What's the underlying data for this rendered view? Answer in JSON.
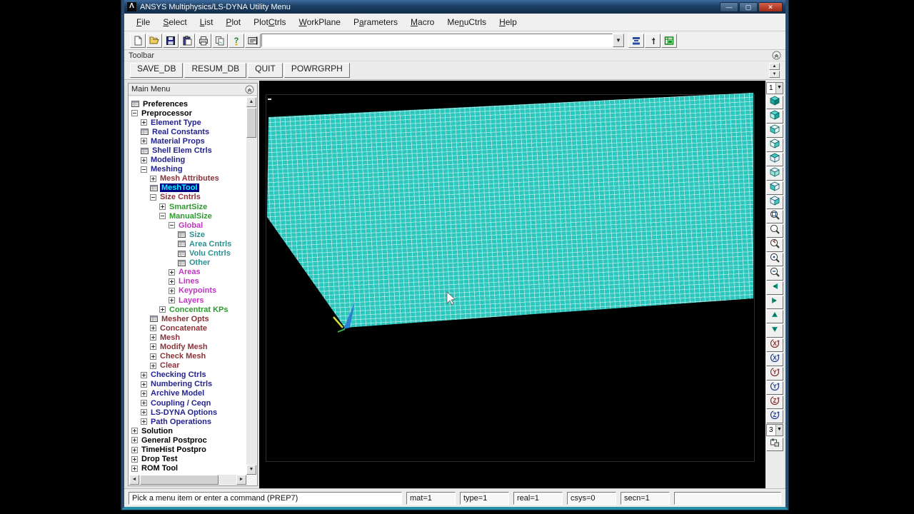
{
  "window": {
    "title": "ANSYS Multiphysics/LS-DYNA Utility Menu",
    "controls": [
      {
        "name": "minimize-button",
        "glyph": "—"
      },
      {
        "name": "maximize-button",
        "glyph": "▢"
      },
      {
        "name": "close-button",
        "glyph": "✕"
      }
    ]
  },
  "menu_bar": {
    "items": [
      {
        "label": "File",
        "hotkey_index": 0
      },
      {
        "label": "Select",
        "hotkey_index": 0
      },
      {
        "label": "List",
        "hotkey_index": 0
      },
      {
        "label": "Plot",
        "hotkey_index": 0
      },
      {
        "label": "PlotCtrls",
        "hotkey_index": 4
      },
      {
        "label": "WorkPlane",
        "hotkey_index": 0
      },
      {
        "label": "Parameters",
        "hotkey_index": 1
      },
      {
        "label": "Macro",
        "hotkey_index": 0
      },
      {
        "label": "MenuCtrls",
        "hotkey_index": 2
      },
      {
        "label": "Help",
        "hotkey_index": 0
      }
    ]
  },
  "standard_toolbar": {
    "left_icons": [
      "new-file-icon",
      "open-folder-icon",
      "save-icon",
      "paste-icon",
      "print-icon",
      "copy-icon",
      "help-key-icon"
    ],
    "command_button_icon": "command-entry-icon",
    "command_input": {
      "value": "",
      "placeholder": ""
    },
    "dropdown_glyph": "▼",
    "right_icons": [
      "raise-hidden-icon",
      "reset-picking-icon",
      "contact-manager-icon"
    ]
  },
  "toolbar_panel": {
    "label": "Toolbar",
    "buttons": [
      "SAVE_DB",
      "RESUM_DB",
      "QUIT",
      "POWRGRPH"
    ],
    "scroll_up_glyph": "▲",
    "scroll_down_glyph": "▼"
  },
  "main_menu": {
    "title": "Main Menu",
    "palette": {
      "black": "#000000",
      "navy": "#24248f",
      "maroon": "#8b3338",
      "green": "#2f9a2f",
      "magenta": "#c433c4",
      "teal": "#2e8f8f"
    },
    "selected_bg": "#000080",
    "selected_fg": "#00ffff",
    "items": [
      {
        "label": "Preferences",
        "level": 0,
        "icon": "sheet",
        "color": "black"
      },
      {
        "label": "Preprocessor",
        "level": 0,
        "icon": "minus",
        "color": "black"
      },
      {
        "label": "Element Type",
        "level": 1,
        "icon": "plus",
        "color": "navy"
      },
      {
        "label": "Real Constants",
        "level": 1,
        "icon": "sheet",
        "color": "navy"
      },
      {
        "label": "Material Props",
        "level": 1,
        "icon": "plus",
        "color": "navy"
      },
      {
        "label": "Shell Elem Ctrls",
        "level": 1,
        "icon": "sheet",
        "color": "navy"
      },
      {
        "label": "Modeling",
        "level": 1,
        "icon": "plus",
        "color": "navy"
      },
      {
        "label": "Meshing",
        "level": 1,
        "icon": "minus",
        "color": "navy"
      },
      {
        "label": "Mesh Attributes",
        "level": 2,
        "icon": "plus",
        "color": "maroon"
      },
      {
        "label": "MeshTool",
        "level": 2,
        "icon": "sheet",
        "color": "maroon",
        "selected": true
      },
      {
        "label": "Size Cntrls",
        "level": 2,
        "icon": "minus",
        "color": "maroon"
      },
      {
        "label": "SmartSize",
        "level": 3,
        "icon": "plus",
        "color": "green"
      },
      {
        "label": "ManualSize",
        "level": 3,
        "icon": "minus",
        "color": "green"
      },
      {
        "label": "Global",
        "level": 4,
        "icon": "minus",
        "color": "magenta"
      },
      {
        "label": "Size",
        "level": 5,
        "icon": "sheet",
        "color": "teal"
      },
      {
        "label": "Area Cntrls",
        "level": 5,
        "icon": "sheet",
        "color": "teal"
      },
      {
        "label": "Volu Cntrls",
        "level": 5,
        "icon": "sheet",
        "color": "teal"
      },
      {
        "label": "Other",
        "level": 5,
        "icon": "sheet",
        "color": "teal"
      },
      {
        "label": "Areas",
        "level": 4,
        "icon": "plus",
        "color": "magenta"
      },
      {
        "label": "Lines",
        "level": 4,
        "icon": "plus",
        "color": "magenta"
      },
      {
        "label": "Keypoints",
        "level": 4,
        "icon": "plus",
        "color": "magenta"
      },
      {
        "label": "Layers",
        "level": 4,
        "icon": "plus",
        "color": "magenta"
      },
      {
        "label": "Concentrat KPs",
        "level": 3,
        "icon": "plus",
        "color": "green"
      },
      {
        "label": "Mesher Opts",
        "level": 2,
        "icon": "sheet",
        "color": "maroon"
      },
      {
        "label": "Concatenate",
        "level": 2,
        "icon": "plus",
        "color": "maroon"
      },
      {
        "label": "Mesh",
        "level": 2,
        "icon": "plus",
        "color": "maroon"
      },
      {
        "label": "Modify Mesh",
        "level": 2,
        "icon": "plus",
        "color": "maroon"
      },
      {
        "label": "Check Mesh",
        "level": 2,
        "icon": "plus",
        "color": "maroon"
      },
      {
        "label": "Clear",
        "level": 2,
        "icon": "plus",
        "color": "maroon"
      },
      {
        "label": "Checking Ctrls",
        "level": 1,
        "icon": "plus",
        "color": "navy"
      },
      {
        "label": "Numbering Ctrls",
        "level": 1,
        "icon": "plus",
        "color": "navy"
      },
      {
        "label": "Archive Model",
        "level": 1,
        "icon": "plus",
        "color": "navy"
      },
      {
        "label": "Coupling / Ceqn",
        "level": 1,
        "icon": "plus",
        "color": "navy"
      },
      {
        "label": "LS-DYNA Options",
        "level": 1,
        "icon": "plus",
        "color": "navy"
      },
      {
        "label": "Path Operations",
        "level": 1,
        "icon": "plus",
        "color": "navy"
      },
      {
        "label": "Solution",
        "level": 0,
        "icon": "plus",
        "color": "black"
      },
      {
        "label": "General Postproc",
        "level": 0,
        "icon": "plus",
        "color": "black"
      },
      {
        "label": "TimeHist Postpro",
        "level": 0,
        "icon": "plus",
        "color": "black"
      },
      {
        "label": "Drop Test",
        "level": 0,
        "icon": "plus",
        "color": "black"
      },
      {
        "label": "ROM Tool",
        "level": 0,
        "icon": "plus",
        "color": "black"
      }
    ]
  },
  "graphics": {
    "mesh_fill_color": "#2cc7bc",
    "mesh_line_color": "#b9efe9",
    "triad_color": "#2f7fd0"
  },
  "right_toolbar": {
    "window_select_value": "1",
    "rate_select_value": "3",
    "buttons": [
      "iso-view-icon",
      "oblique-view-icon",
      "front-view-icon",
      "back-view-icon",
      "top-view-icon",
      "bottom-view-icon",
      "left-view-icon",
      "right-view-icon",
      "fit-view-icon",
      "zoom-icon",
      "zoom-back-icon",
      "zoom-in-icon",
      "zoom-out-icon",
      "pan-left-icon",
      "pan-right-icon",
      "pan-up-icon",
      "pan-down-icon",
      "rotate-x-neg-icon",
      "rotate-x-pos-icon",
      "rotate-y-neg-icon",
      "rotate-y-pos-icon",
      "rotate-z-neg-icon",
      "rotate-z-pos-icon"
    ],
    "bottom_icon": "dynamic-mode-icon"
  },
  "status_bar": {
    "prompt": "Pick a menu item or enter a command (PREP7)",
    "fields": [
      "mat=1",
      "type=1",
      "real=1",
      "csys=0",
      "secn=1",
      ""
    ]
  }
}
